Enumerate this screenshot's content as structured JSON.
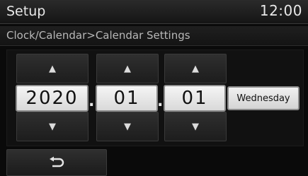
{
  "header": {
    "title": "Setup",
    "clock": "12:00"
  },
  "breadcrumb": "Clock/Calendar>Calendar Settings",
  "date": {
    "year": "2020",
    "month": "01",
    "day": "01",
    "separator": ".",
    "weekday": "Wednesday"
  },
  "icons": {
    "up": "▲",
    "down": "▼"
  },
  "back_button": {
    "icon": "back-arrow-icon"
  }
}
